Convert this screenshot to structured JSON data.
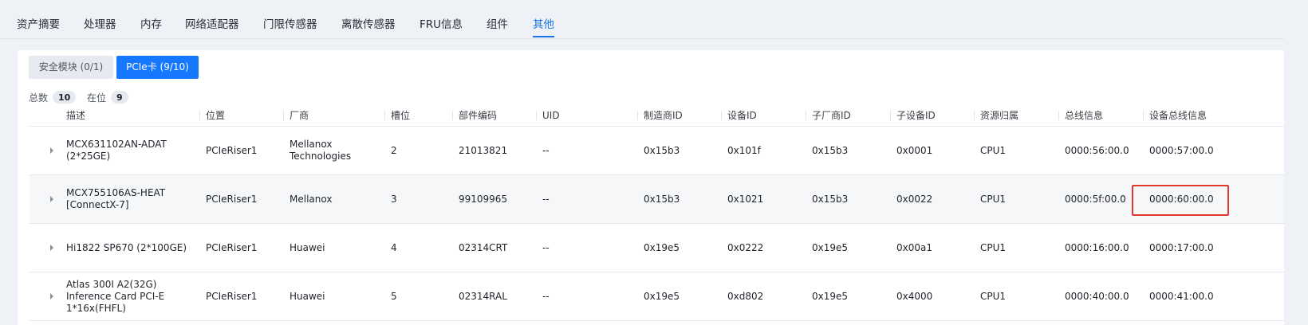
{
  "top_tabs": [
    {
      "label": "资产摘要",
      "active": false
    },
    {
      "label": "处理器",
      "active": false
    },
    {
      "label": "内存",
      "active": false
    },
    {
      "label": "网络适配器",
      "active": false
    },
    {
      "label": "门限传感器",
      "active": false
    },
    {
      "label": "离散传感器",
      "active": false
    },
    {
      "label": "FRU信息",
      "active": false
    },
    {
      "label": "组件",
      "active": false
    },
    {
      "label": "其他",
      "active": true
    }
  ],
  "sub_tabs": [
    {
      "label": "安全模块 (0/1)",
      "active": false
    },
    {
      "label": "PCIe卡 (9/10)",
      "active": true
    }
  ],
  "stats": {
    "total_label": "总数",
    "total_value": "10",
    "present_label": "在位",
    "present_value": "9"
  },
  "table": {
    "columns": [
      "描述",
      "位置",
      "厂商",
      "槽位",
      "部件编码",
      "UID",
      "制造商ID",
      "设备ID",
      "子厂商ID",
      "子设备ID",
      "资源归属",
      "总线信息",
      "设备总线信息"
    ],
    "rows": [
      [
        "MCX631102AN-ADAT (2*25GE)",
        "PCIeRiser1",
        "Mellanox Technologies",
        "2",
        "21013821",
        "--",
        "0x15b3",
        "0x101f",
        "0x15b3",
        "0x0001",
        "CPU1",
        "0000:56:00.0",
        "0000:57:00.0"
      ],
      [
        "MCX755106AS-HEAT [ConnectX-7]",
        "PCIeRiser1",
        "Mellanox",
        "3",
        "99109965",
        "--",
        "0x15b3",
        "0x1021",
        "0x15b3",
        "0x0022",
        "CPU1",
        "0000:5f:00.0",
        "0000:60:00.0"
      ],
      [
        "Hi1822 SP670 (2*100GE)",
        "PCIeRiser1",
        "Huawei",
        "4",
        "02314CRT",
        "--",
        "0x19e5",
        "0x0222",
        "0x19e5",
        "0x00a1",
        "CPU1",
        "0000:16:00.0",
        "0000:17:00.0"
      ],
      [
        "Atlas 300I A2(32G) Inference Card PCI-E 1*16x(FHFL)",
        "PCIeRiser1",
        "Huawei",
        "5",
        "02314RAL",
        "--",
        "0x19e5",
        "0xd802",
        "0x19e5",
        "0x4000",
        "CPU1",
        "0000:40:00.0",
        "0000:41:00.0"
      ]
    ]
  },
  "colors": {
    "accent": "#1677ff",
    "highlight_border": "#e0382f"
  }
}
